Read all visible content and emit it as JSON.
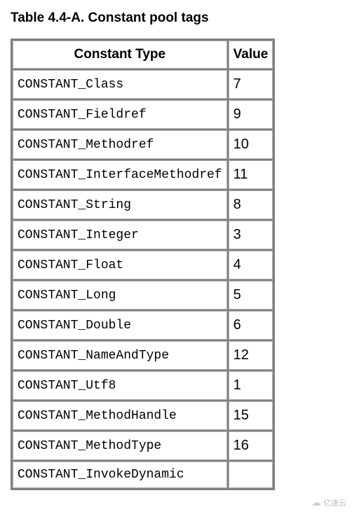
{
  "title": "Table 4.4-A. Constant pool tags",
  "headers": {
    "col1": "Constant Type",
    "col2": "Value"
  },
  "rows": [
    {
      "type": "CONSTANT_Class",
      "value": "7"
    },
    {
      "type": "CONSTANT_Fieldref",
      "value": "9"
    },
    {
      "type": "CONSTANT_Methodref",
      "value": "10"
    },
    {
      "type": "CONSTANT_InterfaceMethodref",
      "value": "11"
    },
    {
      "type": "CONSTANT_String",
      "value": "8"
    },
    {
      "type": "CONSTANT_Integer",
      "value": "3"
    },
    {
      "type": "CONSTANT_Float",
      "value": "4"
    },
    {
      "type": "CONSTANT_Long",
      "value": "5"
    },
    {
      "type": "CONSTANT_Double",
      "value": "6"
    },
    {
      "type": "CONSTANT_NameAndType",
      "value": "12"
    },
    {
      "type": "CONSTANT_Utf8",
      "value": "1"
    },
    {
      "type": "CONSTANT_MethodHandle",
      "value": "15"
    },
    {
      "type": "CONSTANT_MethodType",
      "value": "16"
    },
    {
      "type": "CONSTANT_InvokeDynamic",
      "value": ""
    }
  ],
  "watermark": "亿速云"
}
